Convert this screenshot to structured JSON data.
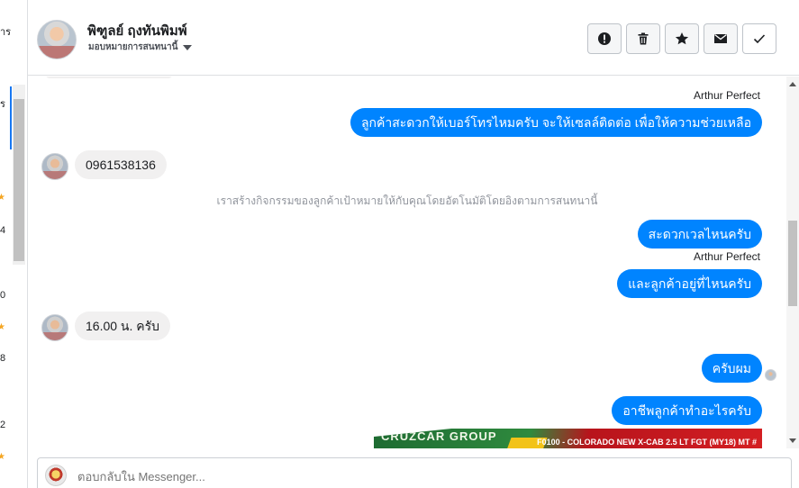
{
  "left_strip": {
    "fragments": [
      "าร",
      "ร",
      "4",
      "0",
      "8",
      "2"
    ]
  },
  "header": {
    "contact_name": "พิฑูลย์ ฤงทันพิมพ์",
    "assign_label": "มอบหมายการสนทนานี้",
    "actions": [
      {
        "icon": "exclamation-circle-icon"
      },
      {
        "icon": "trash-icon"
      },
      {
        "icon": "star-icon"
      },
      {
        "icon": "envelope-icon"
      },
      {
        "icon": "checkmark-icon"
      }
    ]
  },
  "conversation": {
    "messages": [
      {
        "sender": "Arthur Perfect",
        "text": "ลูกค้าสะดวกให้เบอร์โทรไหมครับ จะให้เซลล์ติดต่อ เพื่อให้ความช่วยเหลือ"
      },
      {
        "text": "0961538136"
      },
      {
        "system": "เราสร้างกิจกรรมของลูกค้าเป้าหมายให้กับคุณโดยอัตโนมัติโดยอิงตามการสนทนานี้"
      },
      {
        "text": "สะดวกเวลไหนครับ"
      },
      {
        "sender": "Arthur Perfect",
        "text": "และลูกค้าอยู่ที่ไหนครับ"
      },
      {
        "text": "16.00 น. ครับ"
      },
      {
        "text": "ครับผม"
      },
      {
        "text": "อาชีพลูกค้าทำอะไรครับ"
      }
    ],
    "ad_image": {
      "left_text": "CRUZCAR GROUP",
      "right_text": "F0100 - COLORADO NEW X-CAB 2.5 LT FGT (MY18) MT #"
    }
  },
  "reply": {
    "placeholder": "ตอบกลับใน Messenger..."
  },
  "colors": {
    "outgoing_bubble": "#0084ff",
    "incoming_bubble": "#f1f0f0",
    "accent": "#1877f2"
  }
}
